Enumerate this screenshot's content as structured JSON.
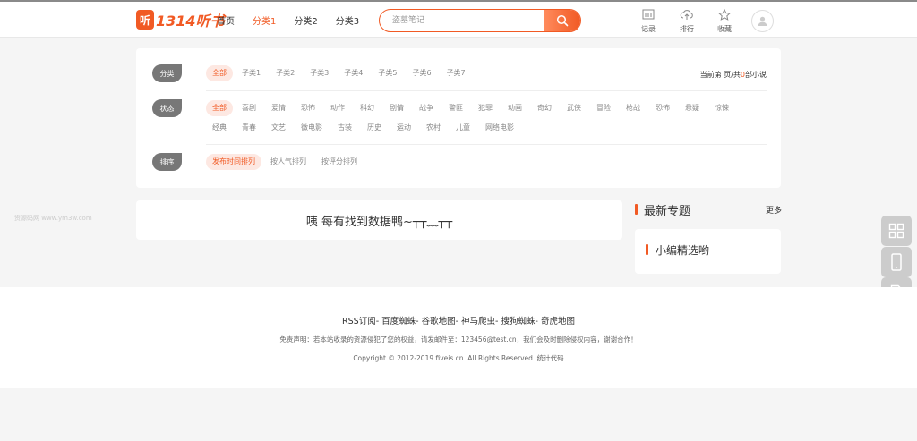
{
  "header": {
    "logo_badge": "听",
    "logo_text": "1314听书",
    "nav": [
      "首页",
      "分类1",
      "分类2",
      "分类3"
    ],
    "active_nav_index": 1,
    "search": {
      "placeholder": "盗墓笔记",
      "value": ""
    },
    "icons": [
      {
        "label": "记录",
        "icon": "history-icon"
      },
      {
        "label": "排行",
        "icon": "upload-cloud-icon"
      },
      {
        "label": "收藏",
        "icon": "star-icon"
      }
    ],
    "accent": "#f15a24"
  },
  "filter": {
    "category": {
      "tag": "分类",
      "options": [
        "全部",
        "子类1",
        "子类2",
        "子类3",
        "子类4",
        "子类5",
        "子类6",
        "子类7"
      ]
    },
    "page_info": {
      "prefix": "当前第",
      "mid": "页/共",
      "count": "0",
      "suffix": "部小说"
    },
    "status": {
      "tag": "状态",
      "options": [
        "全部",
        "喜剧",
        "爱情",
        "恐怖",
        "动作",
        "科幻",
        "剧情",
        "战争",
        "警匪",
        "犯罪",
        "动画",
        "奇幻",
        "武侠",
        "冒险",
        "枪战",
        "恐怖",
        "悬疑",
        "惊悚",
        "经典",
        "青春",
        "文艺",
        "微电影",
        "古装",
        "历史",
        "运动",
        "农村",
        "儿童",
        "网络电影"
      ]
    },
    "sort": {
      "tag": "排序",
      "options": [
        "发布时间排列",
        "按人气排列",
        "按评分排列"
      ]
    }
  },
  "empty_message": "咦 每有找到数据鸭~┬┬﹏┬┬",
  "side": {
    "title": "最新专题",
    "more": "更多",
    "card_title": "小编精选哟"
  },
  "watermark": "资源码网 www.ym3w.com",
  "float_tools": [
    "qrcode-icon",
    "mobile-icon",
    "document-icon"
  ],
  "footer": {
    "links": "RSS订阅- 百度蜘蛛- 谷歌地图- 神马爬虫- 搜狗蜘蛛- 奇虎地图",
    "disclaimer": "免责声明：若本站收录的资源侵犯了您的权益，请发邮件至：123456@test.cn，我们会及时删除侵权内容，谢谢合作！",
    "copyright": "Copyright © 2012-2019 fiveis.cn. All Rights Reserved. 统计代码"
  }
}
